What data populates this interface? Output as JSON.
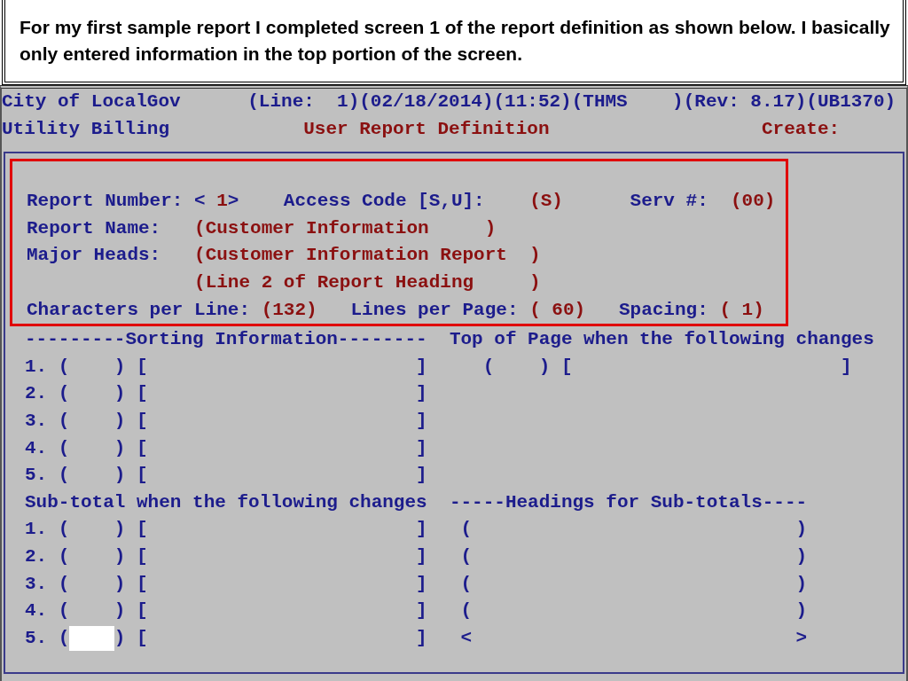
{
  "caption": "For my first sample report I completed screen 1 of the report definition as shown below.  I basically only entered information in the top portion of the screen.",
  "terminal": {
    "header_lines": [
      {
        "segments": [
          {
            "kind": "label",
            "text": "City of LocalGov      (Line:  1)(02/18/2014)(11:52)(THMS    )(Rev: 8.17)(UB1370)"
          }
        ]
      },
      {
        "segments": [
          {
            "kind": "label",
            "text": "Utility Billing"
          },
          {
            "kind": "title",
            "text": "            User Report Definition"
          },
          {
            "kind": "title",
            "text": "                   Create:"
          }
        ]
      }
    ],
    "form": {
      "highlighted_lines": [
        {
          "segments": [
            {
              "kind": "label",
              "text": "Report Number: <"
            },
            {
              "kind": "value",
              "text": " 1"
            },
            {
              "kind": "label",
              "text": ">    Access Code [S,U]:    "
            },
            {
              "kind": "value",
              "text": "(S)"
            },
            {
              "kind": "label",
              "text": "      Serv #:  "
            },
            {
              "kind": "value",
              "text": "(00)"
            }
          ]
        },
        {
          "segments": [
            {
              "kind": "label",
              "text": "Report Name:   "
            },
            {
              "kind": "value",
              "text": "(Customer Information     )"
            }
          ]
        },
        {
          "segments": [
            {
              "kind": "label",
              "text": "Major Heads:   "
            },
            {
              "kind": "value",
              "text": "(Customer Information Report  )"
            }
          ]
        },
        {
          "segments": [
            {
              "kind": "value",
              "text": "               (Line 2 of Report Heading     )"
            }
          ]
        },
        {
          "segments": [
            {
              "kind": "label",
              "text": "Characters per Line: "
            },
            {
              "kind": "value",
              "text": "(132)"
            },
            {
              "kind": "label",
              "text": "   Lines per Page: "
            },
            {
              "kind": "value",
              "text": "( 60)"
            },
            {
              "kind": "label",
              "text": "   Spacing: "
            },
            {
              "kind": "value",
              "text": "( 1)"
            }
          ]
        }
      ],
      "lines": [
        {
          "segments": [
            {
              "kind": "label",
              "text": "---------Sorting Information--------  Top of Page when the following changes"
            }
          ]
        },
        {
          "segments": [
            {
              "kind": "label",
              "text": "1. (    ) [                        ]     (    ) [                        ]"
            }
          ]
        },
        {
          "segments": [
            {
              "kind": "label",
              "text": "2. (    ) [                        ]"
            }
          ]
        },
        {
          "segments": [
            {
              "kind": "label",
              "text": "3. (    ) [                        ]"
            }
          ]
        },
        {
          "segments": [
            {
              "kind": "label",
              "text": "4. (    ) [                        ]"
            }
          ]
        },
        {
          "segments": [
            {
              "kind": "label",
              "text": "5. (    ) [                        ]"
            }
          ]
        },
        {
          "segments": [
            {
              "kind": "label",
              "text": "Sub-total when the following changes  -----Headings for Sub-totals----"
            }
          ]
        },
        {
          "segments": [
            {
              "kind": "label",
              "text": "1. (    ) [                        ]   (                             )"
            }
          ]
        },
        {
          "segments": [
            {
              "kind": "label",
              "text": "2. (    ) [                        ]   (                             )"
            }
          ]
        },
        {
          "segments": [
            {
              "kind": "label",
              "text": "3. (    ) [                        ]   (                             )"
            }
          ]
        },
        {
          "segments": [
            {
              "kind": "label",
              "text": "4. (    ) [                        ]   (                             )"
            }
          ]
        },
        {
          "segments": [
            {
              "kind": "label",
              "text": "5. ("
            },
            {
              "kind": "cursor"
            },
            {
              "kind": "label",
              "text": ") [                        ]   <                             >"
            }
          ]
        }
      ]
    }
  }
}
